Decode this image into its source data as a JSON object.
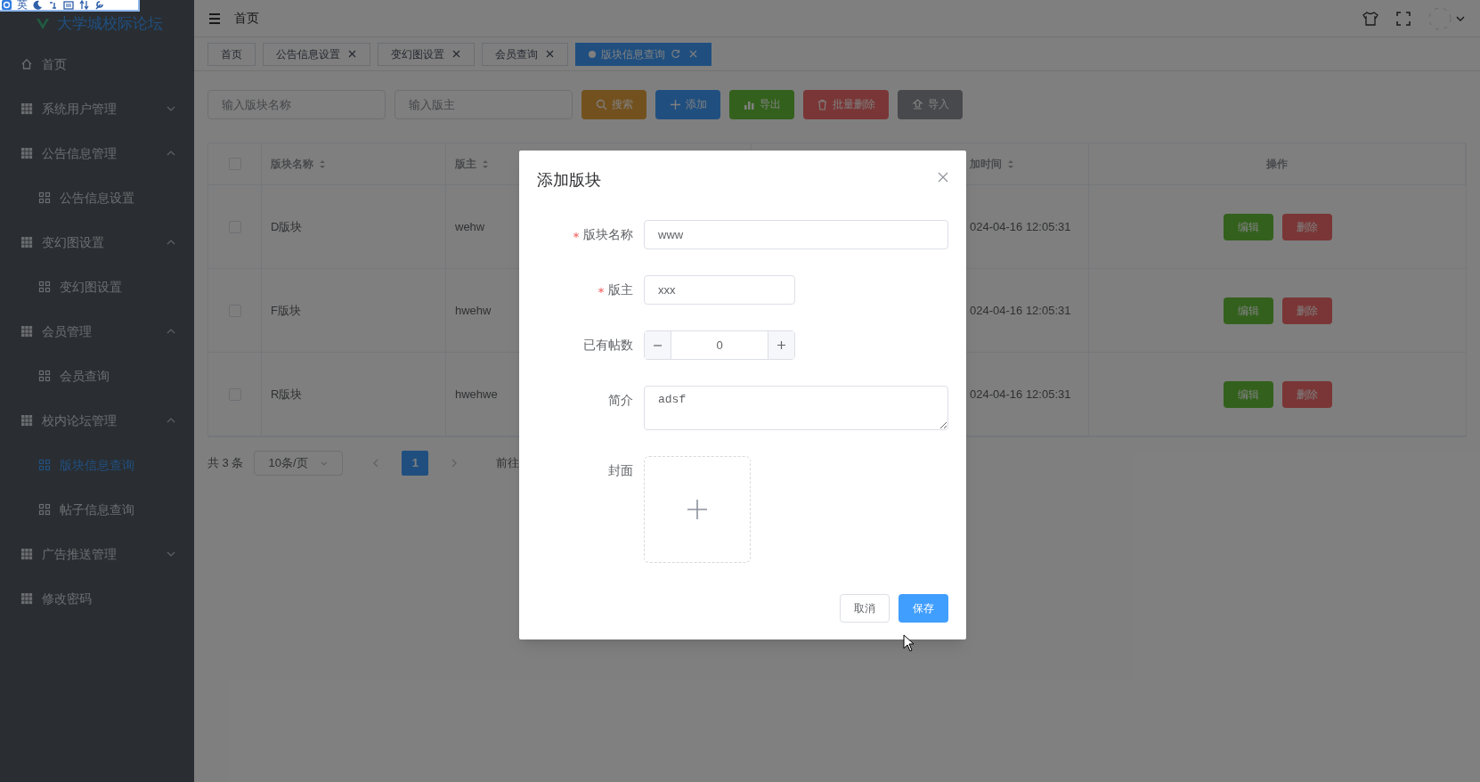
{
  "ime_toolbar": {
    "label": "英"
  },
  "sidebar": {
    "logo": "大学城校际论坛",
    "items": [
      {
        "label": "首页",
        "kind": "home",
        "selected": false
      },
      {
        "label": "系统用户管理",
        "kind": "group",
        "expanded": false
      },
      {
        "label": "公告信息管理",
        "kind": "group",
        "expanded": true,
        "children": [
          {
            "label": "公告信息设置",
            "selected": false
          }
        ]
      },
      {
        "label": "变幻图设置",
        "kind": "group",
        "expanded": true,
        "children": [
          {
            "label": "变幻图设置",
            "selected": false
          }
        ]
      },
      {
        "label": "会员管理",
        "kind": "group",
        "expanded": true,
        "children": [
          {
            "label": "会员查询",
            "selected": false
          }
        ]
      },
      {
        "label": "校内论坛管理",
        "kind": "group",
        "expanded": true,
        "children": [
          {
            "label": "版块信息查询",
            "selected": true
          },
          {
            "label": "帖子信息查询",
            "selected": false
          }
        ]
      },
      {
        "label": "广告推送管理",
        "kind": "group",
        "expanded": false
      },
      {
        "label": "修改密码",
        "kind": "link",
        "selected": false
      }
    ]
  },
  "header": {
    "breadcrumb": "首页"
  },
  "tabs": [
    {
      "label": "首页",
      "closable": false,
      "selected": false
    },
    {
      "label": "公告信息设置",
      "closable": true,
      "selected": false
    },
    {
      "label": "变幻图设置",
      "closable": true,
      "selected": false
    },
    {
      "label": "会员查询",
      "closable": true,
      "selected": false
    },
    {
      "label": "版块信息查询",
      "closable": true,
      "selected": true
    }
  ],
  "toolbar": {
    "search_fields": [
      {
        "placeholder": "输入版块名称"
      },
      {
        "placeholder": "输入版主"
      }
    ],
    "buttons": [
      {
        "label": "搜索",
        "kind": "search"
      },
      {
        "label": "添加",
        "kind": "add"
      },
      {
        "label": "导出",
        "kind": "export"
      },
      {
        "label": "批量删除",
        "kind": "delete"
      },
      {
        "label": "导入",
        "kind": "import"
      }
    ]
  },
  "table": {
    "header_checked": false,
    "columns": [
      {
        "label": "版块名称",
        "sortable": true
      },
      {
        "label": "版主",
        "sortable": true
      },
      {
        "label": "加时间",
        "sortable": true
      },
      {
        "label": "操作",
        "sortable": false
      }
    ],
    "rows": [
      {
        "checked": false,
        "name": "D版块",
        "owner": "wehw",
        "time": "024-04-16 12:05:31",
        "actions": [
          {
            "label": "编辑",
            "kind": "edit"
          },
          {
            "label": "删除",
            "kind": "delete"
          }
        ]
      },
      {
        "checked": false,
        "name": "F版块",
        "owner": "hwehw",
        "time": "024-04-16 12:05:31",
        "actions": [
          {
            "label": "编辑",
            "kind": "edit"
          },
          {
            "label": "删除",
            "kind": "delete"
          }
        ]
      },
      {
        "checked": false,
        "name": "R版块",
        "owner": "hwehwe",
        "time": "024-04-16 12:05:31",
        "actions": [
          {
            "label": "编辑",
            "kind": "edit"
          },
          {
            "label": "删除",
            "kind": "delete"
          }
        ]
      }
    ]
  },
  "pagination": {
    "total": "共 3 条",
    "page_size": "10条/页",
    "pages": [
      {
        "label": "1",
        "selected": true
      }
    ],
    "goto": "前往"
  },
  "dialog": {
    "title": "添加版块",
    "fields": [
      {
        "label": "版块名称",
        "required": true,
        "kind": "text",
        "value": "www"
      },
      {
        "label": "版主",
        "required": true,
        "kind": "short",
        "value": "xxx"
      },
      {
        "label": "已有帖数",
        "required": false,
        "kind": "number",
        "value": "0"
      },
      {
        "label": "简介",
        "required": false,
        "kind": "textarea",
        "value": "adsf"
      },
      {
        "label": "封面",
        "required": false,
        "kind": "upload"
      }
    ],
    "buttons": [
      {
        "label": "取消",
        "kind": "default"
      },
      {
        "label": "保存",
        "kind": "primary"
      }
    ]
  }
}
